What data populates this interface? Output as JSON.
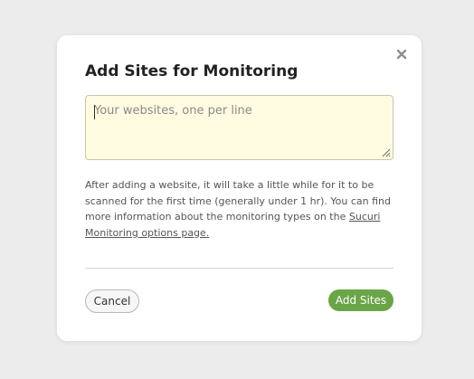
{
  "dialog": {
    "title": "Add Sites for Monitoring",
    "close_icon": "close-icon",
    "websites_input": {
      "value": "",
      "placeholder": "Your websites, one per line"
    },
    "help_text": {
      "before_link": "After adding a website, it will take a little while for it to be scanned for the first time (generally under 1 hr). You can find more information about the monitoring types on the ",
      "link_label": "Sucuri Monitoring options page."
    },
    "cancel_label": "Cancel",
    "add_label": "Add Sites"
  },
  "colors": {
    "backdrop": "#ececec",
    "input_background": "#fffbe0",
    "primary_button": "#6aa547"
  }
}
